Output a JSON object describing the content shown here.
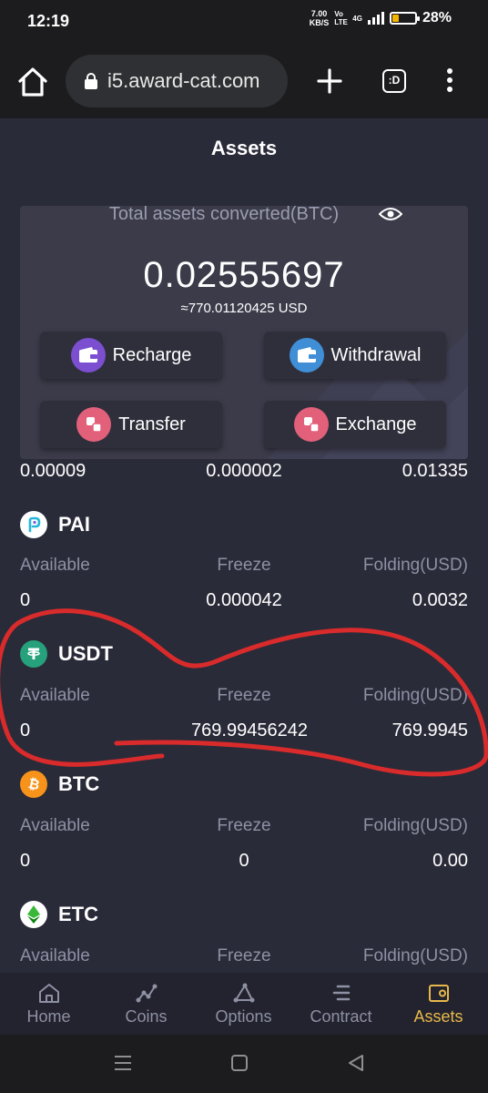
{
  "status": {
    "time": "12:19",
    "net_speed": "7.00",
    "net_unit": "KB/S",
    "sim": "Vo LTE",
    "net_type": "4G",
    "battery": "28%",
    "battery_level": 0.28
  },
  "browser": {
    "url": "i5.award-cat.com",
    "tabs_label": ":D"
  },
  "page": {
    "title": "Assets"
  },
  "summary": {
    "label": "Total assets converted(BTC)",
    "btc_value": "0.02555697",
    "usd_value": "≈770.01120425 USD",
    "actions": {
      "recharge": "Recharge",
      "withdrawal": "Withdrawal",
      "transfer": "Transfer",
      "exchange": "Exchange"
    }
  },
  "partial_row": {
    "available": "0.00009",
    "freeze": "0.000002",
    "folding": "0.01335"
  },
  "columns": {
    "available": "Available",
    "freeze": "Freeze",
    "folding": "Folding(USD)"
  },
  "coins": [
    {
      "name": "PAI",
      "available": "0",
      "freeze": "0.000042",
      "folding": "0.0032"
    },
    {
      "name": "USDT",
      "available": "0",
      "freeze": "769.99456242",
      "folding": "769.9945"
    },
    {
      "name": "BTC",
      "available": "0",
      "freeze": "0",
      "folding": "0.00"
    },
    {
      "name": "ETC"
    }
  ],
  "tabs": [
    {
      "label": "Home"
    },
    {
      "label": "Coins"
    },
    {
      "label": "Options"
    },
    {
      "label": "Contract"
    },
    {
      "label": "Assets"
    }
  ],
  "colors": {
    "accent": "#e8b94a",
    "annotation": "#d92b2b",
    "background": "#2a2b39"
  }
}
